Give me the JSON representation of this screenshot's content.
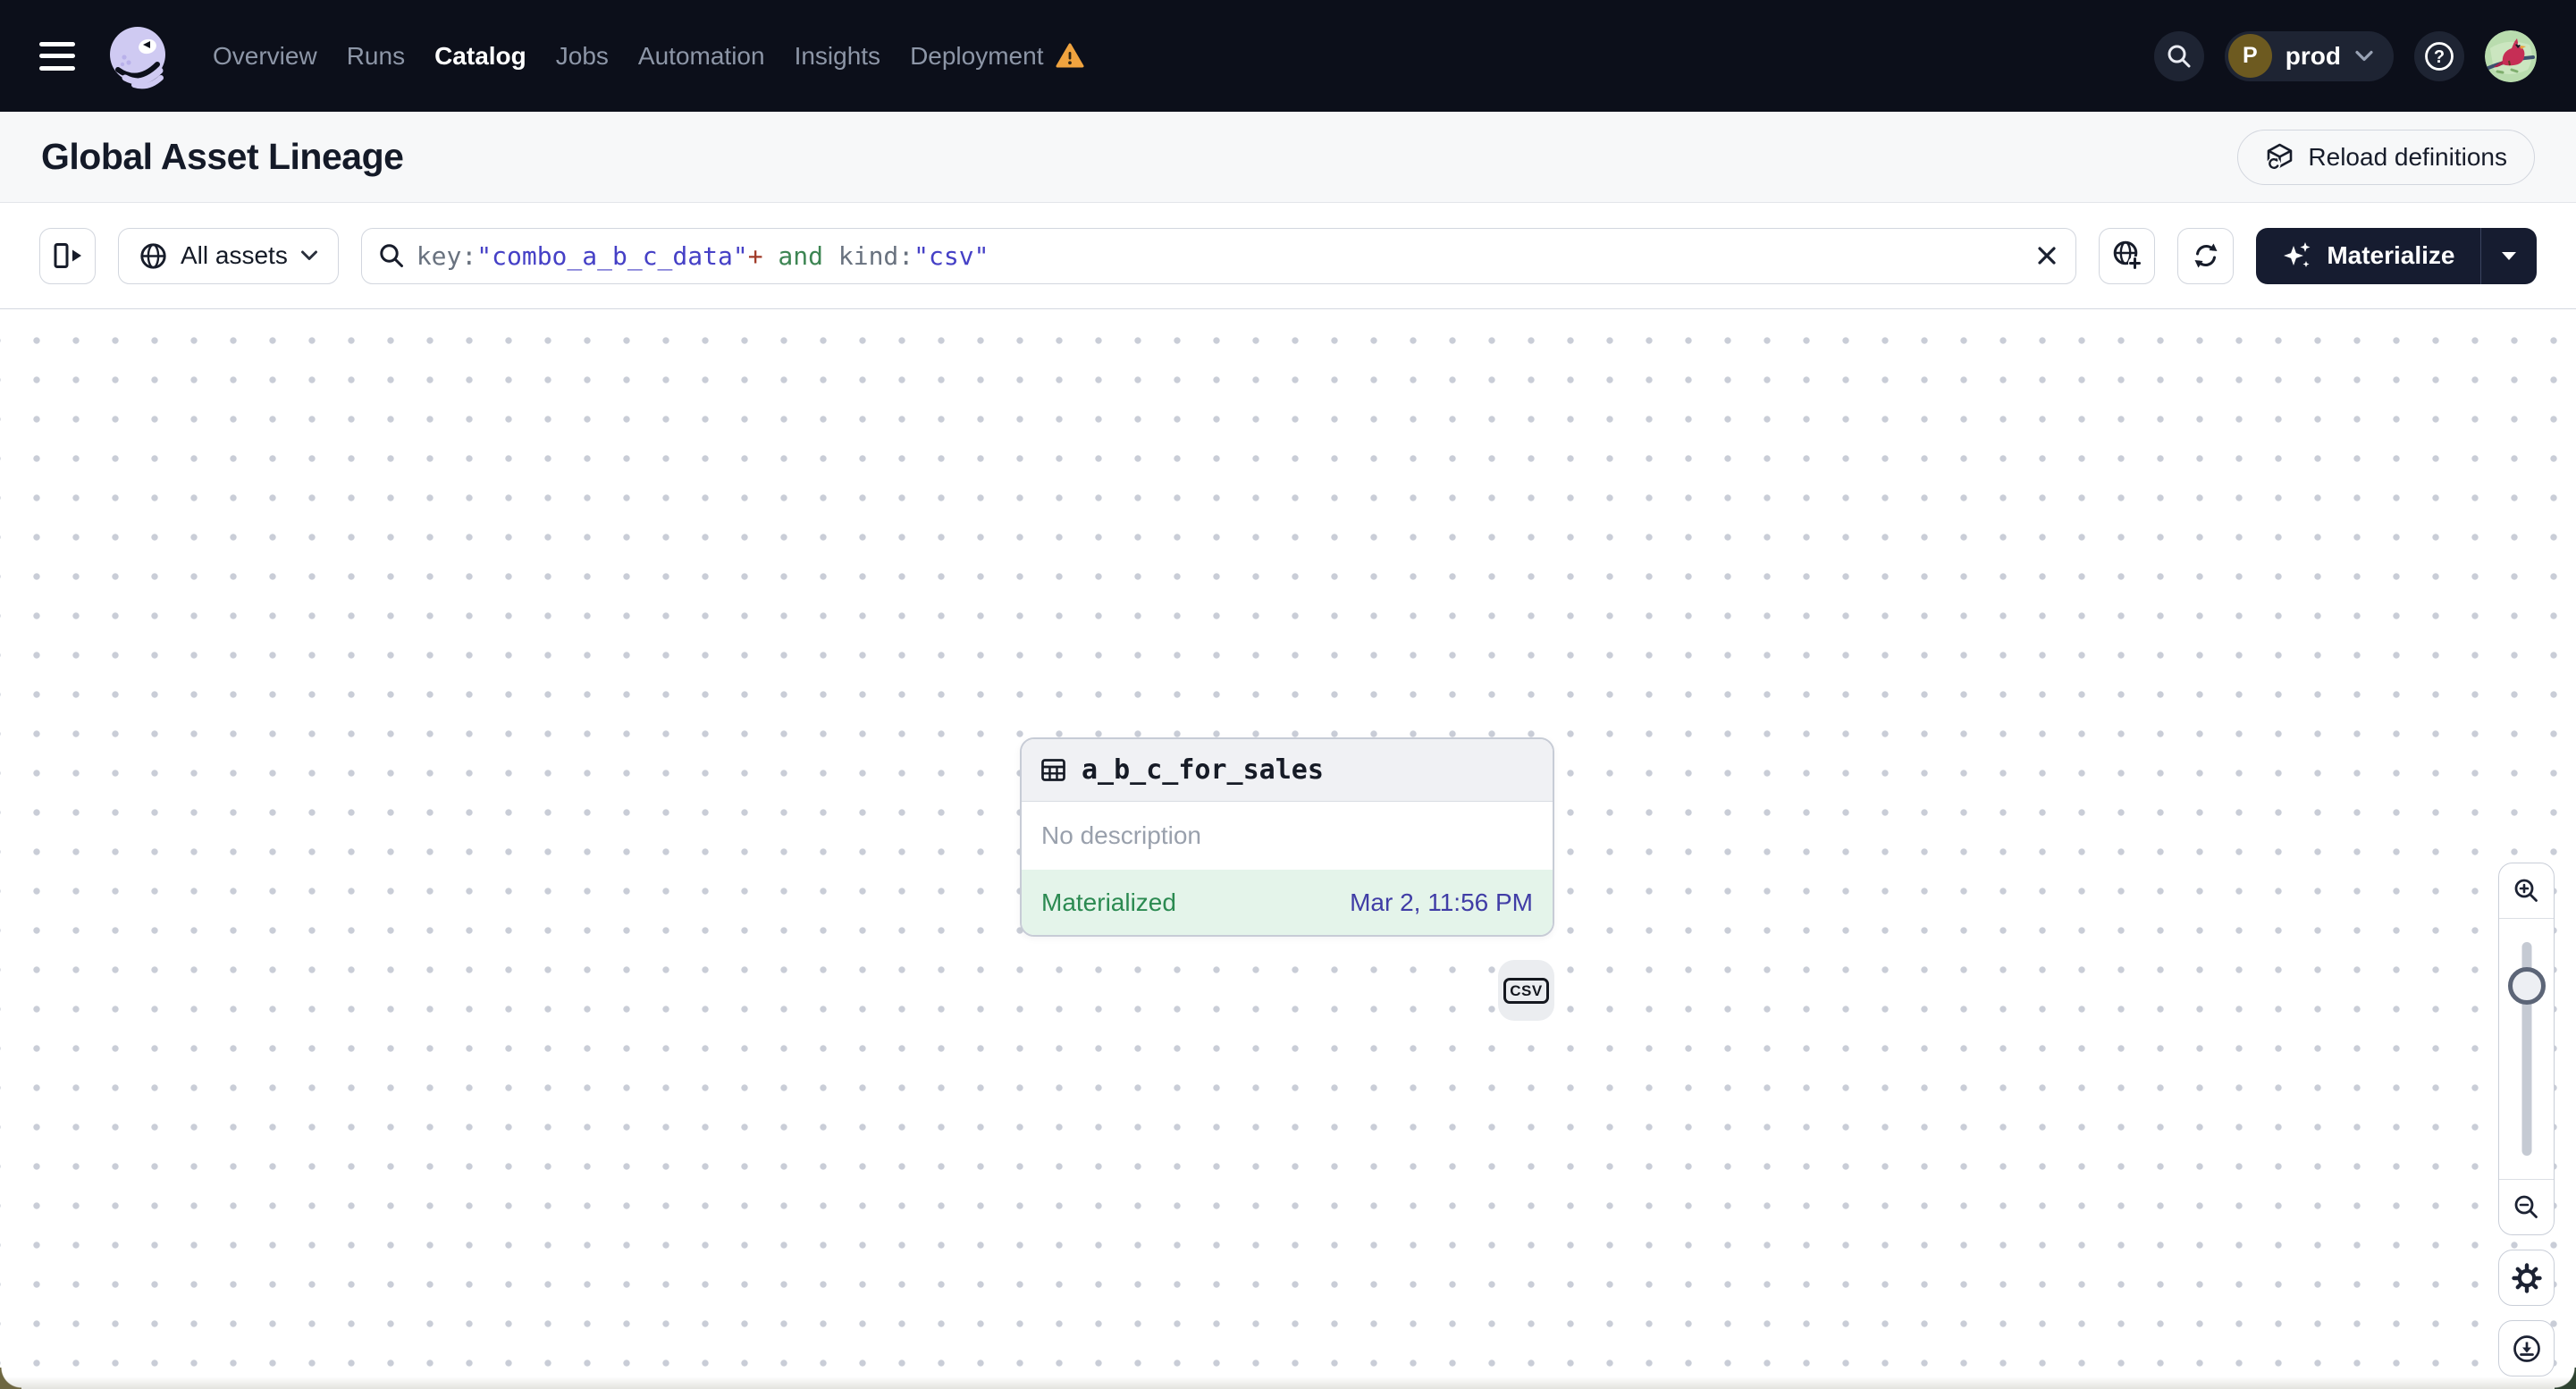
{
  "nav": {
    "items": [
      {
        "label": "Overview",
        "active": false
      },
      {
        "label": "Runs",
        "active": false
      },
      {
        "label": "Catalog",
        "active": true
      },
      {
        "label": "Jobs",
        "active": false
      },
      {
        "label": "Automation",
        "active": false
      },
      {
        "label": "Insights",
        "active": false
      },
      {
        "label": "Deployment",
        "active": false,
        "warning": true
      }
    ],
    "environment": {
      "initial": "P",
      "name": "prod"
    }
  },
  "header": {
    "title": "Global Asset Lineage",
    "reload_label": "Reload definitions"
  },
  "toolbar": {
    "scope_label": "All assets",
    "query_tokens": [
      {
        "text": "key",
        "type": "field"
      },
      {
        "text": ":",
        "type": "field"
      },
      {
        "text": "\"combo_a_b_c_data\"",
        "type": "value"
      },
      {
        "text": "+",
        "type": "op"
      },
      {
        "text": " and ",
        "type": "keyword"
      },
      {
        "text": "kind",
        "type": "field"
      },
      {
        "text": ":",
        "type": "field"
      },
      {
        "text": "\"csv\"",
        "type": "value"
      }
    ],
    "materialize_label": "Materialize"
  },
  "canvas": {
    "node": {
      "name": "a_b_c_for_sales",
      "description": "No description",
      "status": "Materialized",
      "timestamp": "Mar 2, 11:56 PM",
      "kind_tag": "CSV"
    }
  },
  "colors": {
    "status_green": "#2b8a51",
    "status_bg_green": "#e4f4ea",
    "timestamp_indigo": "#403da6",
    "warning_orange": "#f0a33f",
    "query_value_indigo": "#4540c6",
    "nav_bg": "#0c0f1a"
  }
}
